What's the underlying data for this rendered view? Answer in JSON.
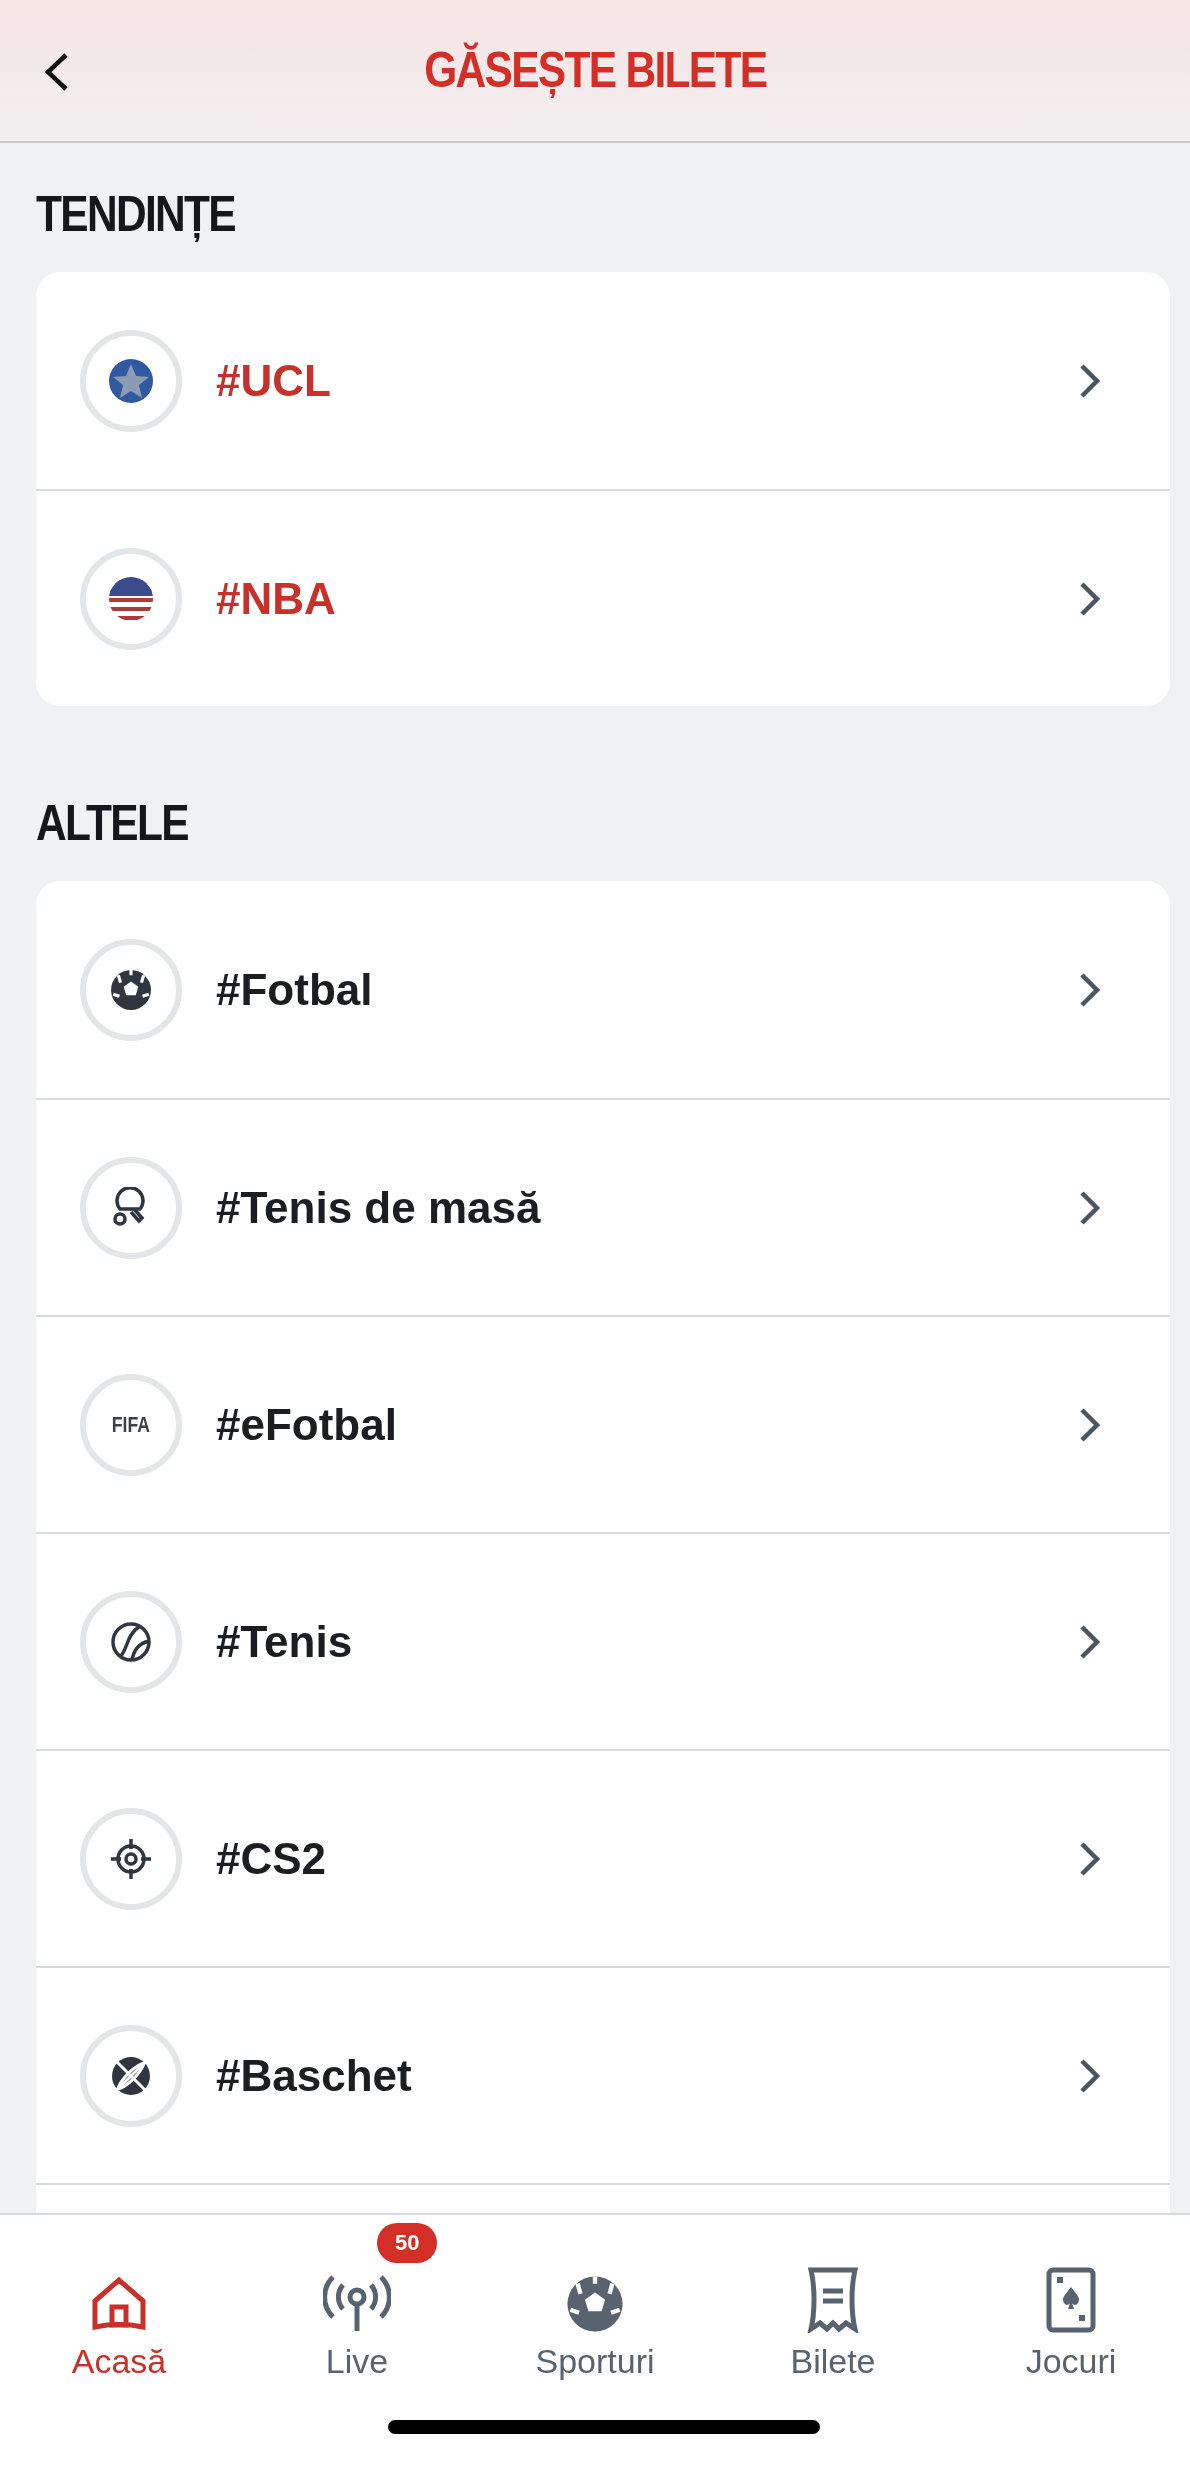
{
  "header": {
    "title": "GĂSEȘTE BILETE"
  },
  "sections": [
    {
      "title": "TENDINȚE",
      "items": [
        {
          "label": "#UCL",
          "kind": "star-ball",
          "highlighted": true
        },
        {
          "label": "#NBA",
          "kind": "flag",
          "highlighted": true
        }
      ]
    },
    {
      "title": "ALTELE",
      "more_below": true,
      "items": [
        {
          "label": "#Fotbal",
          "kind": "soccer",
          "highlighted": false
        },
        {
          "label": "#Tenis de masă",
          "kind": "pingpong",
          "highlighted": false
        },
        {
          "label": "#eFotbal",
          "kind": "text",
          "icon_text": "FIFA",
          "highlighted": false
        },
        {
          "label": "#Tenis",
          "kind": "tennis",
          "highlighted": false
        },
        {
          "label": "#CS2",
          "kind": "target",
          "highlighted": false
        },
        {
          "label": "#Baschet",
          "kind": "basketball",
          "highlighted": false
        }
      ]
    }
  ],
  "bottom_nav": [
    {
      "label": "Acasă",
      "kind": "home",
      "selected": true
    },
    {
      "label": "Live",
      "kind": "live",
      "badge": "50",
      "selected": false
    },
    {
      "label": "Sporturi",
      "kind": "soccer",
      "selected": false
    },
    {
      "label": "Bilete",
      "kind": "ticket",
      "selected": false
    },
    {
      "label": "Jocuri",
      "kind": "card",
      "selected": false
    }
  ]
}
